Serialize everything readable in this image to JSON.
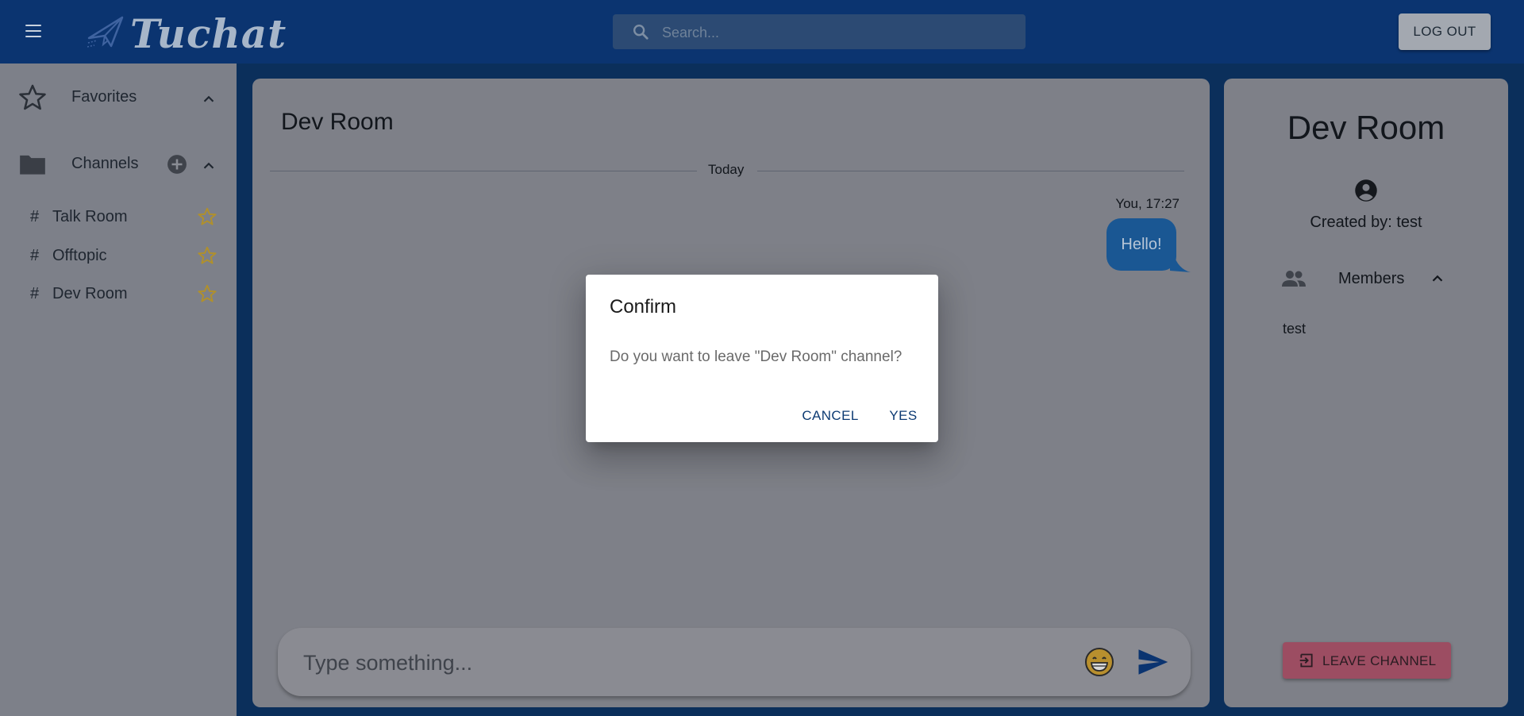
{
  "header": {
    "app_name": "Tuchat",
    "search_placeholder": "Search...",
    "logout_label": "LOG OUT"
  },
  "sidebar": {
    "favorites_label": "Favorites",
    "channels_label": "Channels",
    "channels": [
      {
        "name": "Talk Room",
        "prefix": "#"
      },
      {
        "name": "Offtopic",
        "prefix": "#"
      },
      {
        "name": "Dev Room",
        "prefix": "#"
      }
    ]
  },
  "chat": {
    "title": "Dev Room",
    "date_divider": "Today",
    "messages": [
      {
        "meta": "You, 17:27",
        "text": "Hello!"
      }
    ],
    "composer_placeholder": "Type something..."
  },
  "info": {
    "title": "Dev Room",
    "created_by": "Created by: test",
    "members_label": "Members",
    "members": [
      "test"
    ],
    "leave_label": "LEAVE CHANNEL"
  },
  "dialog": {
    "title": "Confirm",
    "message": "Do you want to leave \"Dev Room\" channel?",
    "cancel_label": "CANCEL",
    "yes_label": "YES"
  },
  "colors": {
    "header_bg": "#0b3470",
    "frame_bg": "#0b2f5b",
    "sidebar_bg": "#7d8089",
    "panel_bg": "#7e8088",
    "bubble_bg": "#1a5793",
    "star_color": "#b0902c",
    "leave_button_bg": "#9c4d62",
    "dialog_button_text": "#0d3b73"
  },
  "icons": {
    "menu": "hamburger-menu-icon",
    "logo": "paper-plane-icon",
    "search": "search-icon",
    "favorites": "star-outline-icon",
    "channels": "folder-icon",
    "add": "add-circle-icon",
    "chevron": "chevron-up-icon",
    "channel_favorite": "star-outline-icon",
    "emoji": "emoji-grin-icon",
    "send": "send-icon",
    "account": "account-circle-icon",
    "members": "people-icon",
    "leave": "exit-to-app-icon"
  }
}
